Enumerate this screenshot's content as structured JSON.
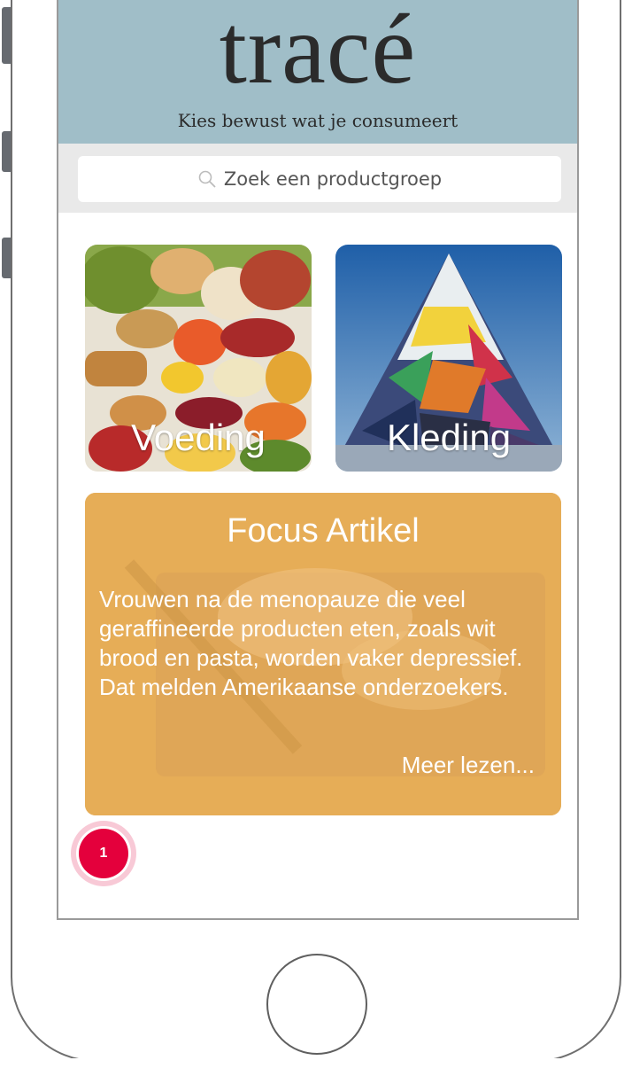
{
  "header": {
    "brand": "tracé",
    "tagline": "Kies bewust wat je consumeert"
  },
  "search": {
    "placeholder": "Zoek een productgroep",
    "icon": "search-icon"
  },
  "categories": [
    {
      "label": "Voeding",
      "icon": "food-photo"
    },
    {
      "label": "Kleding",
      "icon": "clothes-photo"
    }
  ],
  "focus": {
    "title": "Focus Artikel",
    "body": "Vrouwen na de menopauze die veel geraffineerde producten eten, zoals wit brood en pasta, worden vaker depressief. Dat melden Amerikaanse onderzoekers.",
    "more_label": "Meer lezen..."
  },
  "notification": {
    "count": "1"
  },
  "colors": {
    "header_bg": "#a0bec8",
    "search_bar_bg": "#e9e9e9",
    "focus_bg": "#e6ad57",
    "badge": "#e4003c"
  }
}
